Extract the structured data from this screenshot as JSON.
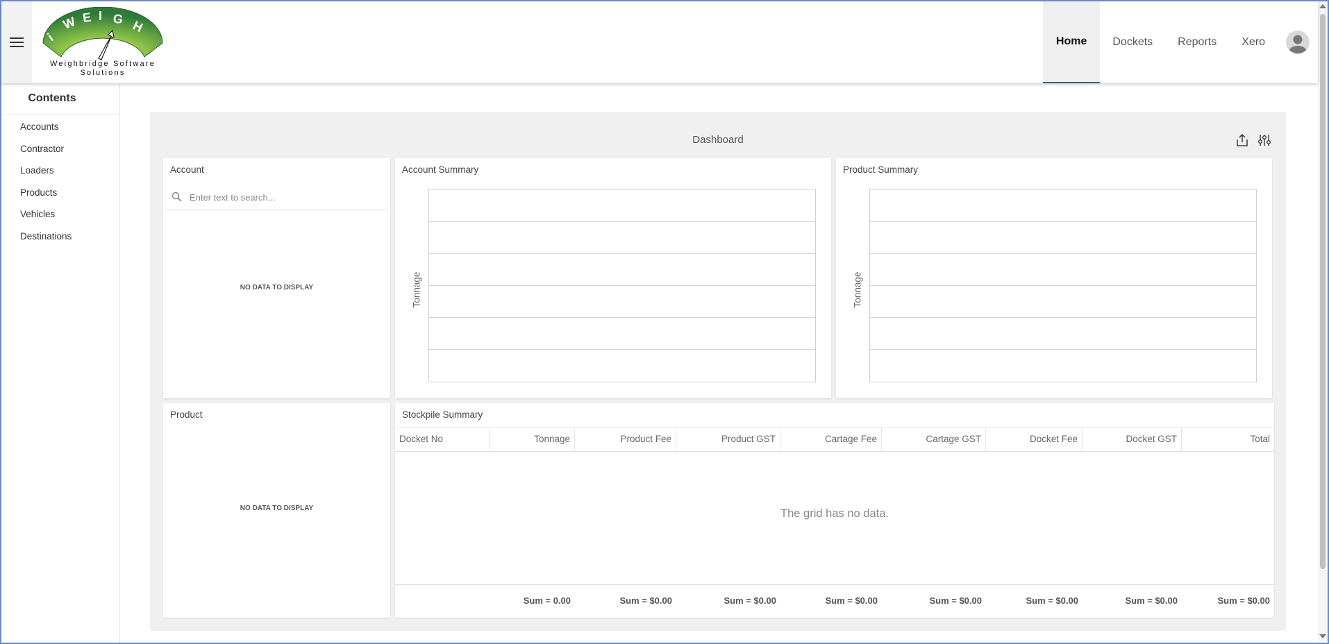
{
  "header": {
    "logo_text": "iWEIGH",
    "logo_tagline": "Weighbridge Software Solutions",
    "nav": [
      {
        "label": "Home",
        "active": true
      },
      {
        "label": "Dockets"
      },
      {
        "label": "Reports"
      },
      {
        "label": "Xero"
      }
    ]
  },
  "sidebar": {
    "title": "Contents",
    "items": [
      {
        "label": "Accounts"
      },
      {
        "label": "Contractor"
      },
      {
        "label": "Loaders"
      },
      {
        "label": "Products"
      },
      {
        "label": "Vehicles"
      },
      {
        "label": "Destinations"
      }
    ]
  },
  "dashboard": {
    "title": "Dashboard",
    "account_panel": {
      "title": "Account",
      "search_placeholder": "Enter text to search...",
      "empty": "NO DATA TO DISPLAY"
    },
    "product_panel": {
      "title": "Product",
      "empty": "NO DATA TO DISPLAY"
    },
    "account_summary": {
      "title": "Account Summary",
      "ylabel": "Tonnage"
    },
    "product_summary": {
      "title": "Product Summary",
      "ylabel": "Tonnage"
    },
    "stockpile": {
      "title": "Stockpile Summary",
      "columns": [
        "Docket No",
        "Tonnage",
        "Product Fee",
        "Product GST",
        "Cartage Fee",
        "Cartage GST",
        "Docket Fee",
        "Docket GST",
        "Total"
      ],
      "empty": "The grid has no data.",
      "sums": [
        "",
        "Sum = 0.00",
        "Sum = $0.00",
        "Sum = $0.00",
        "Sum = $0.00",
        "Sum = $0.00",
        "Sum = $0.00",
        "Sum = $0.00",
        "Sum = $0.00"
      ]
    }
  },
  "colors": {
    "accent": "#3c5a8c",
    "logo_green": "#2f7a3a",
    "frame": "#6b8cc7"
  },
  "icons": [
    "hamburger-icon",
    "user-avatar-icon",
    "export-icon",
    "settings-sliders-icon",
    "search-icon"
  ]
}
